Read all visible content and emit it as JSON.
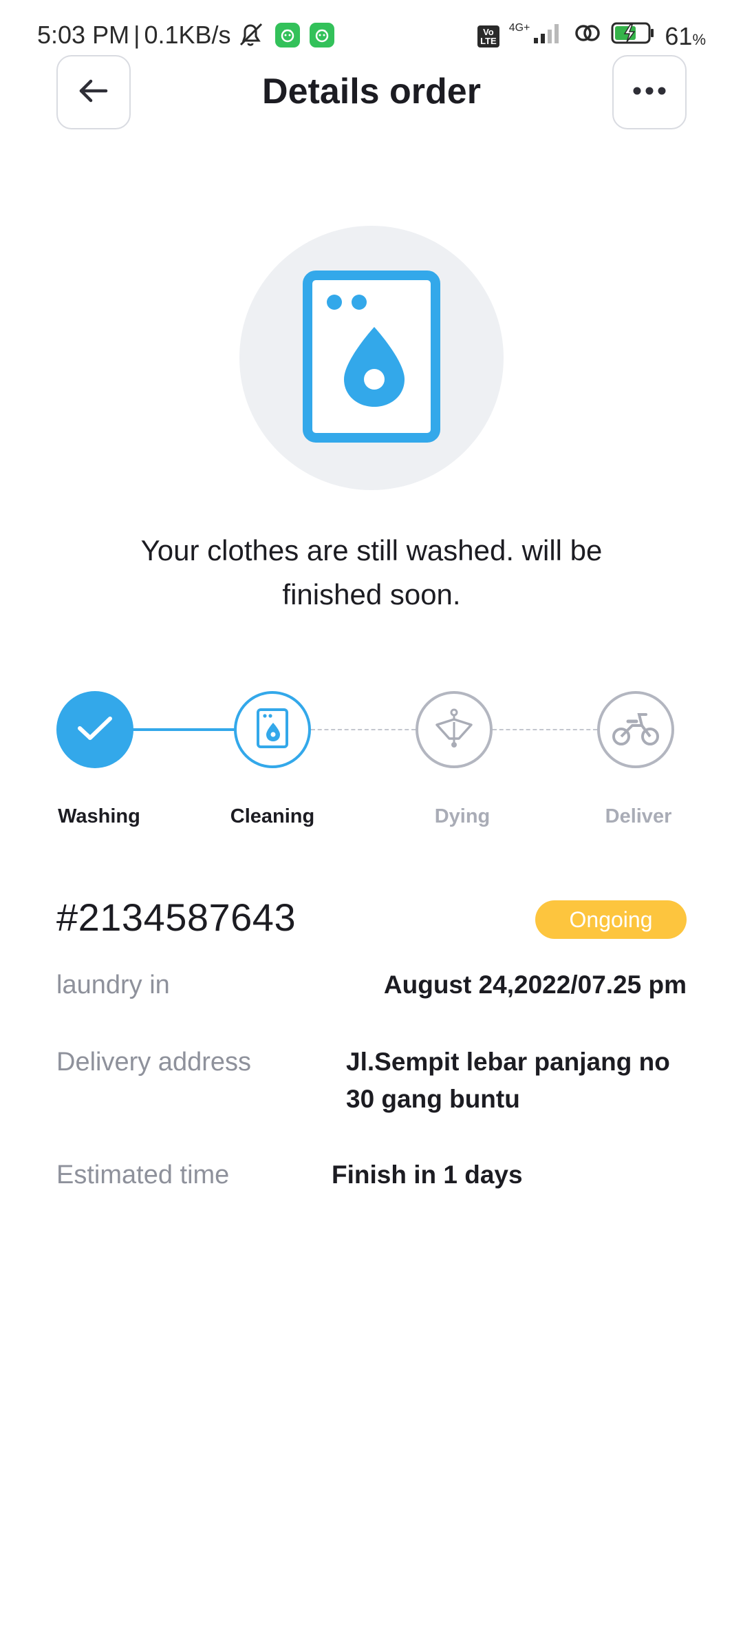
{
  "status_bar": {
    "time": "5:03 PM",
    "separator": "|",
    "net_speed": "0.1KB/s",
    "network_type": "4G+",
    "volte_label": "Vo\nLTE",
    "battery_percent": "61",
    "battery_unit": "%"
  },
  "header": {
    "title": "Details order",
    "back_icon": "arrow-left-icon",
    "more_icon": "more-horizontal-icon"
  },
  "hero": {
    "icon": "washing-machine-icon",
    "message": "Your clothes are still washed. will be finished soon."
  },
  "progress": {
    "steps": [
      {
        "label": "Washing",
        "state": "done",
        "icon": "check-icon"
      },
      {
        "label": "Cleaning",
        "state": "active",
        "icon": "washing-machine-icon"
      },
      {
        "label": "Dying",
        "state": "pending",
        "icon": "clothes-hanger-icon"
      },
      {
        "label": "Deliver",
        "state": "pending",
        "icon": "motorbike-icon"
      }
    ]
  },
  "order": {
    "id": "#2134587643",
    "status": "Ongoing",
    "details": [
      {
        "label": "laundry in",
        "value": "August 24,2022/07.25 pm"
      },
      {
        "label": "Delivery address",
        "value_lines": [
          "Jl.Sempit lebar panjang no",
          "30 gang buntu"
        ]
      },
      {
        "label": "Estimated time",
        "value": "Finish in 1 days"
      }
    ]
  },
  "colors": {
    "accent": "#33a8ea",
    "badge": "#fdc53e",
    "muted_text": "#8e919b",
    "pending_step": "#b3b6c0",
    "hero_bg": "#eef0f3"
  }
}
